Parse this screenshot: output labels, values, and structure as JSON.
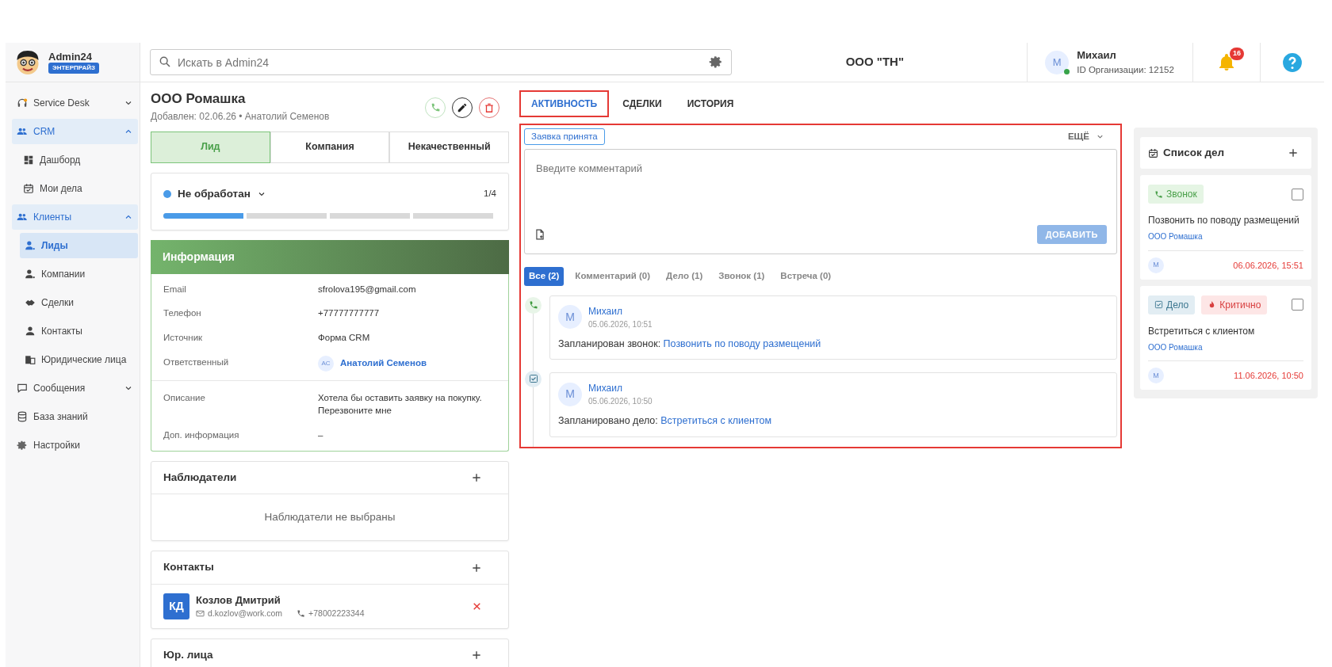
{
  "brand": {
    "name": "Admin24",
    "plan": "ЭНТЕРПРАЙЗ"
  },
  "search": {
    "placeholder": "Искать в Admin24"
  },
  "org_title": "ООО \"ТН\"",
  "user": {
    "avatar": "М",
    "name": "Михаил",
    "org_id": "ID Организации: 12152",
    "online": true
  },
  "notifications": {
    "count": "16"
  },
  "sidebar": {
    "items": [
      {
        "label": "Service Desk",
        "expanded": false,
        "selected": false
      },
      {
        "label": "CRM",
        "expanded": true,
        "selected": false,
        "children": [
          {
            "label": "Дашборд",
            "selected": false
          },
          {
            "label": "Мои дела",
            "selected": false
          },
          {
            "label": "Клиенты",
            "expanded": true,
            "selected": false,
            "children": [
              {
                "label": "Лиды",
                "selected": true
              },
              {
                "label": "Компании",
                "selected": false
              },
              {
                "label": "Сделки",
                "selected": false
              },
              {
                "label": "Контакты",
                "selected": false
              },
              {
                "label": "Юридические лица",
                "selected": false
              }
            ]
          }
        ]
      },
      {
        "label": "Сообщения",
        "expanded": false,
        "selected": false
      },
      {
        "label": "База знаний",
        "selected": false
      },
      {
        "label": "Настройки",
        "selected": false
      }
    ]
  },
  "lead": {
    "title": "ООО Ромашка",
    "meta": "Добавлен: 02.06.26 • Анатолий Семенов",
    "stages": [
      {
        "label": "Лид",
        "selected": true
      },
      {
        "label": "Компания",
        "selected": false
      },
      {
        "label": "Некачественный",
        "selected": false
      }
    ],
    "status": {
      "label": "Не обработан",
      "color": "#4a9be8",
      "step": "1/4",
      "level": 0.25
    }
  },
  "info": {
    "title": "Информация",
    "groups": [
      [
        {
          "label": "Email",
          "value": "sfrolova195@gmail.com",
          "kind": "text"
        },
        {
          "label": "Телефон",
          "value": "+77777777777",
          "kind": "text"
        },
        {
          "label": "Источник",
          "value": "Форма CRM",
          "kind": "text"
        },
        {
          "label": "Ответственный",
          "value": "Анатолий Семенов",
          "kind": "person",
          "avatar": "АС"
        }
      ],
      [
        {
          "label": "Описание",
          "value": "Хотела бы оставить заявку на покупку. Перезвоните мне",
          "kind": "text"
        },
        {
          "label": "Доп. информация",
          "value": "–",
          "kind": "text"
        }
      ]
    ]
  },
  "watchers": {
    "title": "Наблюдатели",
    "empty": "Наблюдатели не выбраны"
  },
  "contacts": {
    "title": "Контакты",
    "items": [
      {
        "initials": "КД",
        "name": "Козлов Дмитрий",
        "email": "d.kozlov@work.com",
        "phone": "+78002223344"
      }
    ]
  },
  "legal": {
    "title": "Юр. лица"
  },
  "tabs": [
    {
      "label": "АКТИВНОСТЬ",
      "selected": true,
      "highlighted": true
    },
    {
      "label": "СДЕЛКИ",
      "selected": false,
      "highlighted": false
    },
    {
      "label": "ИСТОРИЯ",
      "selected": false,
      "highlighted": false
    }
  ],
  "activity": {
    "highlighted": true,
    "stage_tag": "Заявка принята",
    "more": "ЕЩЁ",
    "comment": {
      "placeholder": "Введите комментарий"
    },
    "add_button": {
      "label": "ДОБАВИТЬ",
      "disabled": true
    },
    "filters": [
      {
        "label": "Все (2)",
        "selected": true
      },
      {
        "label": "Комментарий (0)",
        "selected": false
      },
      {
        "label": "Дело (1)",
        "selected": false
      },
      {
        "label": "Звонок (1)",
        "selected": false
      },
      {
        "label": "Встреча (0)",
        "selected": false
      }
    ],
    "events": [
      {
        "kind": "call",
        "author": "Михаил",
        "avatar": "М",
        "time": "05.06.2026, 10:51",
        "text": "Запланирован звонок:",
        "link": "Позвонить по поводу размещений"
      },
      {
        "kind": "task",
        "author": "Михаил",
        "avatar": "М",
        "time": "05.06.2026, 10:50",
        "text": "Запланировано дело:",
        "link": "Встретиться с клиентом"
      }
    ]
  },
  "todo": {
    "title": "Список дел",
    "items": [
      {
        "tags": [
          {
            "kind": "call",
            "label": "Звонок"
          }
        ],
        "checked": false,
        "title": "Позвонить по поводу размещений",
        "company": "ООО Ромашка",
        "avatar": "М",
        "due": "06.06.2026, 15:51"
      },
      {
        "tags": [
          {
            "kind": "task",
            "label": "Дело"
          },
          {
            "kind": "critical",
            "label": "Критично"
          }
        ],
        "checked": false,
        "title": "Встретиться с клиентом",
        "company": "ООО Ромашка",
        "avatar": "М",
        "due": "11.06.2026, 10:50"
      }
    ]
  }
}
